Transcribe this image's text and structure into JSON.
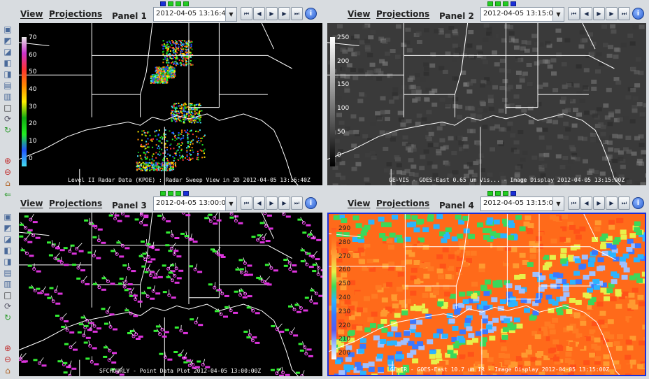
{
  "app": {
    "name": "IDV multi-panel display"
  },
  "side_toolbar_icons": [
    "cube-view-icon",
    "cube-top-icon",
    "cube-bottom-icon",
    "cube-north-icon",
    "cube-south-icon",
    "cube-east-icon",
    "cube-west-icon",
    "square-view-icon",
    "rotate-icon",
    "refresh-icon",
    "zoom-in-icon",
    "zoom-out-icon",
    "home-icon",
    "back-icon"
  ],
  "panels": [
    {
      "id": "panel1",
      "menu_view": "View",
      "menu_projections": "Projections",
      "title": "Panel 1",
      "time": "2012-04-05 13:16:40Z",
      "time_steps": 4,
      "current_step": 1,
      "legend": {
        "labels": [
          "70",
          "60",
          "50",
          "40",
          "30",
          "20",
          "10",
          "0"
        ],
        "colors": [
          "#e8e8e8",
          "#cc33cc",
          "#ff3333",
          "#ff8800",
          "#ffee00",
          "#11aa11",
          "#22ee22",
          "#2255ff",
          "#44ddee"
        ]
      },
      "caption": "Level II Radar Data (KPOE) : Radar Sweep View in 2D 2012-04-05 13:16:40Z",
      "background": "#000000"
    },
    {
      "id": "panel2",
      "menu_view": "View",
      "menu_projections": "Projections",
      "title": "Panel 2",
      "time": "2012-04-05 13:15:00Z",
      "time_steps": 4,
      "current_step": 4,
      "legend": {
        "labels": [
          "250",
          "200",
          "150",
          "100",
          "50",
          "0"
        ],
        "colors": [
          "#ffffff",
          "#000000"
        ]
      },
      "caption": "GE-VIS - GOES-East 0.65 um Vis... - Image Display 2012-04-05 13:15:00Z",
      "background": "#3a3a3a"
    },
    {
      "id": "panel3",
      "menu_view": "View",
      "menu_projections": "Projections",
      "title": "Panel 3",
      "time": "2012-04-05 13:00:00Z",
      "time_steps": 4,
      "current_step": 4,
      "legend": null,
      "caption": "SFCHOURLY - Point Data Plot 2012-04-05 13:00:00Z",
      "background": "#000000"
    },
    {
      "id": "panel4",
      "menu_view": "View",
      "menu_projections": "Projections",
      "title": "Panel 4",
      "time": "2012-04-05 13:15:00Z",
      "time_steps": 4,
      "current_step": 4,
      "legend": {
        "labels": [
          "290",
          "280",
          "270",
          "260",
          "250",
          "240",
          "230",
          "220",
          "210",
          "200"
        ],
        "colors": [
          "#ff5a1e",
          "#ff7a22",
          "#ffa83a",
          "#e8f04a",
          "#3cd85a",
          "#2ab4ff",
          "#3a78ff",
          "#5a5af0",
          "#9fc0ff",
          "#ffffff"
        ]
      },
      "caption": "GE-IR - GOES-East 10.7 um IR - Image Display 2012-04-05 13:15:00Z",
      "background": "#ff6a1a"
    }
  ],
  "anim_buttons": [
    "first-frame",
    "step-back",
    "play",
    "step-forward",
    "last-frame",
    "info"
  ]
}
